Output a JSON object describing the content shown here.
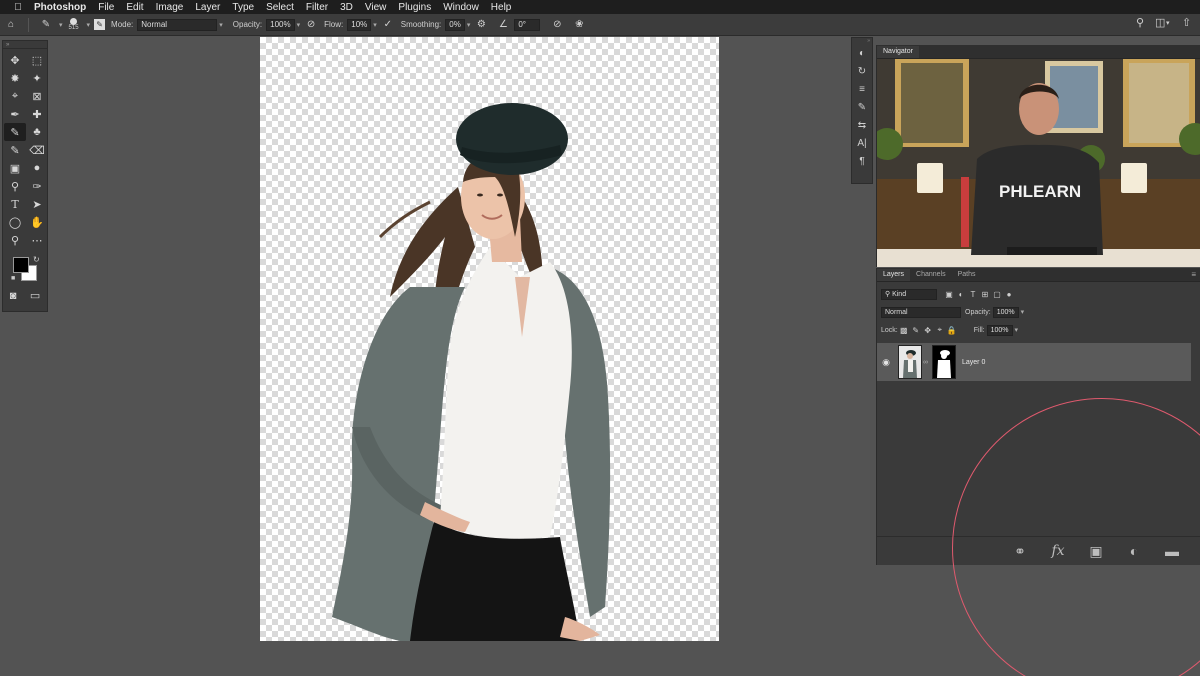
{
  "menubar": {
    "app_name": "Photoshop",
    "items": [
      "File",
      "Edit",
      "Image",
      "Layer",
      "Type",
      "Select",
      "Filter",
      "3D",
      "View",
      "Plugins",
      "Window",
      "Help"
    ]
  },
  "options_bar": {
    "brush_size": "515",
    "mode_label": "Mode:",
    "mode_value": "Normal",
    "opacity_label": "Opacity:",
    "opacity_value": "100%",
    "flow_label": "Flow:",
    "flow_value": "10%",
    "smoothing_label": "Smoothing:",
    "smoothing_value": "0%",
    "angle_value": "0°"
  },
  "navigator": {
    "tab": "Navigator",
    "shirt_text": "PHLEARN"
  },
  "layers_panel": {
    "tabs": [
      "Layers",
      "Channels",
      "Paths"
    ],
    "filter_kind": "Kind",
    "blend_mode": "Normal",
    "opacity_label": "Opacity:",
    "opacity_value": "100%",
    "lock_label": "Lock:",
    "fill_label": "Fill:",
    "fill_value": "100%",
    "layers": [
      {
        "name": "Layer 0"
      }
    ],
    "footer_fx": "fx"
  },
  "colors": {
    "highlight_circle": "#e05a6e",
    "foreground": "#000000",
    "background": "#ffffff"
  }
}
